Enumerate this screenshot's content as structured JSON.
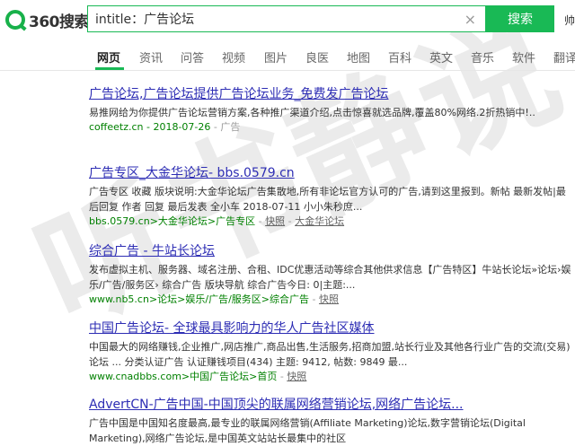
{
  "brand": {
    "logo_text": "360搜索",
    "accent": "#19b955"
  },
  "search": {
    "query": "intitle：广告论坛",
    "button_label": "搜索",
    "clear_symbol": "×",
    "top_right": "帅"
  },
  "nav": [
    "网页",
    "资讯",
    "问答",
    "视频",
    "图片",
    "良医",
    "地图",
    "百科",
    "英文",
    "音乐",
    "软件",
    "翻译"
  ],
  "watermark": "听书静说",
  "results": [
    {
      "title": "广告论坛,广告论坛提供广告论坛业务_免费发广告论坛",
      "desc": "易推网给为你提供广告论坛营销方案,各种推广渠道介绍,点击惊喜就选品牌,覆盖80%网络.2折热销中!..",
      "url": "coffeetz.cn - 2018-07-26",
      "tag": "广告"
    },
    {
      "title": "广告专区_大金华论坛- bbs.0579.cn",
      "desc": "广告专区 收藏 版块说明:大金华论坛广告集散地,所有非论坛官方认可的广告,请到这里报到。新帖 最新发帖|最后回复 作者 回复 最后发表 全小车 2018-07-11 小小朱秒庶...",
      "url": "bbs.0579.cn>大金华论坛>广告专区",
      "snapshot": "快照",
      "extra": "大金华论坛"
    },
    {
      "title": "综合广告 - 牛站长论坛",
      "desc": "发布虚拟主机、服务器、域名注册、合租、IDC优惠活动等综合其他供求信息【广告特区】牛站长论坛»论坛›娱乐/广告/服务区› 综合广告 版块导航 综合广告今日: 0|主题:...",
      "url": "www.nb5.cn>论坛>娱乐/广告/服务区>综合广告",
      "snapshot": "快照"
    },
    {
      "title": "中国广告论坛- 全球最具影响力的华人广告社区媒体",
      "desc": "中国最大的网络赚钱,企业推广,网店推广,商品出售,生活服务,招商加盟,站长行业及其他各行业广告的交流(交易)论坛 ... 分类认证广告 认证赚钱项目(434) 主题: 9412, 帖数: 9849 最...",
      "url": "www.cnadbbs.com>中国广告论坛>首页",
      "snapshot": "快照"
    },
    {
      "title": "AdvertCN-广告中国-中国顶尖的联属网络营销论坛,网络广告论坛...",
      "desc": "广告中国是中国知名度最高,最专业的联属网络营销(Affiliate Marketing)论坛,数字营销论坛(Digital Marketing),网络广告论坛,是中国英文站站长最集中的社区"
    }
  ]
}
